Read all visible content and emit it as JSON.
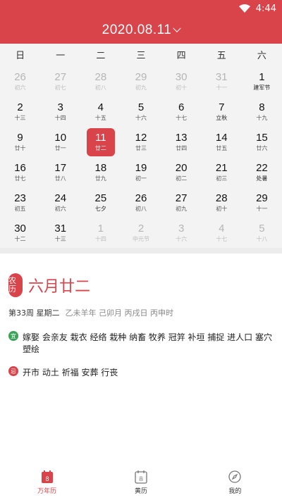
{
  "status": {
    "time": "4:44"
  },
  "header": {
    "title": "2020.08.11"
  },
  "weekdays": [
    "日",
    "一",
    "二",
    "三",
    "四",
    "五",
    "六"
  ],
  "days": [
    {
      "d": "26",
      "l": "初六",
      "dim": true
    },
    {
      "d": "27",
      "l": "初七",
      "dim": true
    },
    {
      "d": "28",
      "l": "初八",
      "dim": true
    },
    {
      "d": "29",
      "l": "初九",
      "dim": true
    },
    {
      "d": "30",
      "l": "初十",
      "dim": true
    },
    {
      "d": "31",
      "l": "十一",
      "dim": true
    },
    {
      "d": "1",
      "l": "建军节",
      "fest": true
    },
    {
      "d": "2",
      "l": "十三"
    },
    {
      "d": "3",
      "l": "十四"
    },
    {
      "d": "4",
      "l": "十五"
    },
    {
      "d": "5",
      "l": "十六"
    },
    {
      "d": "6",
      "l": "十七"
    },
    {
      "d": "7",
      "l": "立秋",
      "fest": true
    },
    {
      "d": "8",
      "l": "十九"
    },
    {
      "d": "9",
      "l": "廿十"
    },
    {
      "d": "10",
      "l": "廿一"
    },
    {
      "d": "11",
      "l": "廿二",
      "sel": true
    },
    {
      "d": "12",
      "l": "廿三"
    },
    {
      "d": "13",
      "l": "廿四"
    },
    {
      "d": "14",
      "l": "廿五"
    },
    {
      "d": "15",
      "l": "廿六"
    },
    {
      "d": "16",
      "l": "廿七"
    },
    {
      "d": "17",
      "l": "廿八"
    },
    {
      "d": "18",
      "l": "廿九"
    },
    {
      "d": "19",
      "l": "初一"
    },
    {
      "d": "20",
      "l": "初二"
    },
    {
      "d": "21",
      "l": "初三"
    },
    {
      "d": "22",
      "l": "处暑",
      "fest": true
    },
    {
      "d": "23",
      "l": "初五"
    },
    {
      "d": "24",
      "l": "初六"
    },
    {
      "d": "25",
      "l": "七夕",
      "fest": true
    },
    {
      "d": "26",
      "l": "初八"
    },
    {
      "d": "27",
      "l": "初九"
    },
    {
      "d": "28",
      "l": "初十"
    },
    {
      "d": "29",
      "l": "十一"
    },
    {
      "d": "30",
      "l": "十二"
    },
    {
      "d": "31",
      "l": "十三"
    },
    {
      "d": "1",
      "l": "十四",
      "dim": true
    },
    {
      "d": "2",
      "l": "中元节",
      "dim": true
    },
    {
      "d": "3",
      "l": "十六",
      "dim": true
    },
    {
      "d": "4",
      "l": "十七",
      "dim": true
    },
    {
      "d": "5",
      "l": "十八",
      "dim": true
    }
  ],
  "detail": {
    "badge": "农历",
    "lunar_date": "六月廿二",
    "week": "第33周 星期二",
    "ganzhi": "乙未羊年 己卯月 丙戌日 丙申时",
    "yi_label": "宜",
    "yi": "嫁娶 会亲友 栽衣 经络 栽种 纳畜 牧养 冠笄 补垣 捕捉 进人口 塞穴 塑绘",
    "ji_label": "忌",
    "ji": "开市 动土 祈福 安葬 行丧"
  },
  "tabs": [
    {
      "label": "万年历",
      "icon_text": "8",
      "active": true
    },
    {
      "label": "黄历",
      "icon_text": "吉"
    },
    {
      "label": "我的"
    }
  ],
  "colors": {
    "accent": "#d9434a",
    "yi": "#3aa35a"
  }
}
